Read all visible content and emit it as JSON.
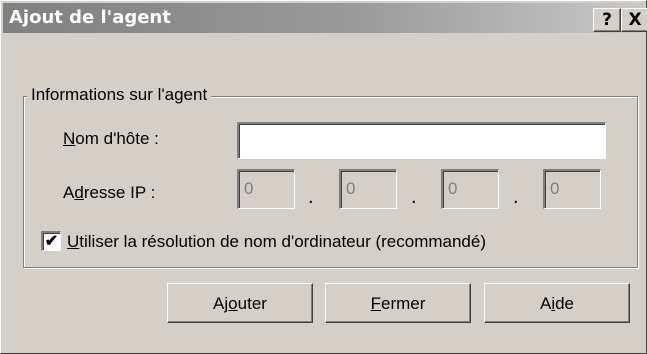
{
  "window": {
    "title": "Ajout de l'agent",
    "help_label": "?",
    "close_label": "X"
  },
  "group": {
    "legend": "Informations sur l'agent"
  },
  "hostname": {
    "label_mnemonic": "N",
    "label_rest": "om d'hôte :",
    "value": ""
  },
  "ip": {
    "label_prefix": "A",
    "label_mnemonic": "d",
    "label_rest": "resse IP :",
    "octets": [
      "0",
      "0",
      "0",
      "0"
    ],
    "separator": "."
  },
  "checkbox": {
    "checked": true,
    "mark": "✔",
    "label_mnemonic": "U",
    "label_rest": "tiliser la résolution de nom d'ordinateur (recommandé)"
  },
  "buttons": {
    "add": {
      "prefix": "Aj",
      "mnemonic": "o",
      "rest": "uter"
    },
    "close": {
      "prefix": "",
      "mnemonic": "F",
      "rest": "ermer"
    },
    "help": {
      "prefix": "A",
      "mnemonic": "i",
      "rest": "de"
    }
  }
}
